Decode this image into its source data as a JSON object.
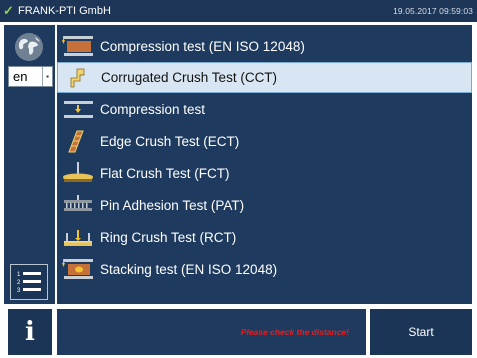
{
  "titlebar": {
    "brand": "FRANK-PTI GmbH",
    "datetime": "19.05.2017 09:59:03"
  },
  "language": {
    "selected": "en"
  },
  "tests": [
    {
      "label": "Compression test (EN ISO 12048)",
      "icon": "compression-box-icon",
      "selected": false
    },
    {
      "label": "Corrugated Crush Test (CCT)",
      "icon": "cct-sample-icon",
      "selected": true
    },
    {
      "label": "Compression test",
      "icon": "compression-plates-icon",
      "selected": false
    },
    {
      "label": "Edge Crush Test (ECT)",
      "icon": "ect-sample-icon",
      "selected": false
    },
    {
      "label": "Flat Crush Test (FCT)",
      "icon": "fct-fixture-icon",
      "selected": false
    },
    {
      "label": "Pin Adhesion Test (PAT)",
      "icon": "pat-fixture-icon",
      "selected": false
    },
    {
      "label": "Ring Crush Test (RCT)",
      "icon": "rct-fixture-icon",
      "selected": false
    },
    {
      "label": "Stacking test (EN ISO 12048)",
      "icon": "stacking-box-icon",
      "selected": false
    }
  ],
  "status": {
    "message": "Please check the distance!"
  },
  "buttons": {
    "start": "Start",
    "info": "i"
  },
  "colors": {
    "panel": "#1e3a5f",
    "titlebar": "#1d3557",
    "selected_row": "#d7e6f2",
    "warning": "#e02020",
    "check": "#8fd14f"
  }
}
